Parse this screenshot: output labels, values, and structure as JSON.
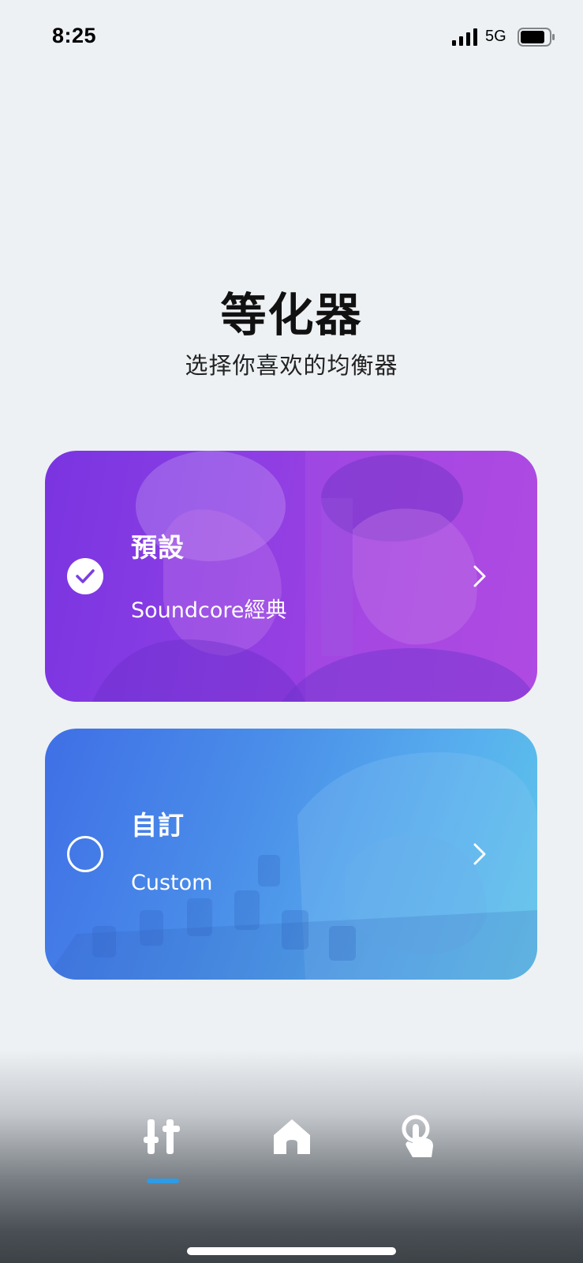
{
  "status_bar": {
    "time": "8:25",
    "network": "5G"
  },
  "header": {
    "title": "等化器",
    "subtitle": "选择你喜欢的均衡器"
  },
  "cards": {
    "preset": {
      "title": "預設",
      "subtitle": "Soundcore經典",
      "selected": true
    },
    "custom": {
      "title": "自訂",
      "subtitle": "Custom",
      "selected": false
    }
  },
  "icons": {
    "status": [
      "signal-icon",
      "battery-icon"
    ],
    "cards": [
      "check-icon",
      "chevron-right-icon"
    ],
    "nav": [
      "equalizer-icon",
      "home-icon",
      "touch-icon"
    ]
  },
  "colors": {
    "preset_card": "#8a3ee4",
    "custom_card": "#4a8ee9",
    "active_indicator": "#2e9be6",
    "background": "#edf1f4"
  },
  "bottom_nav": {
    "active": "equalizer"
  }
}
